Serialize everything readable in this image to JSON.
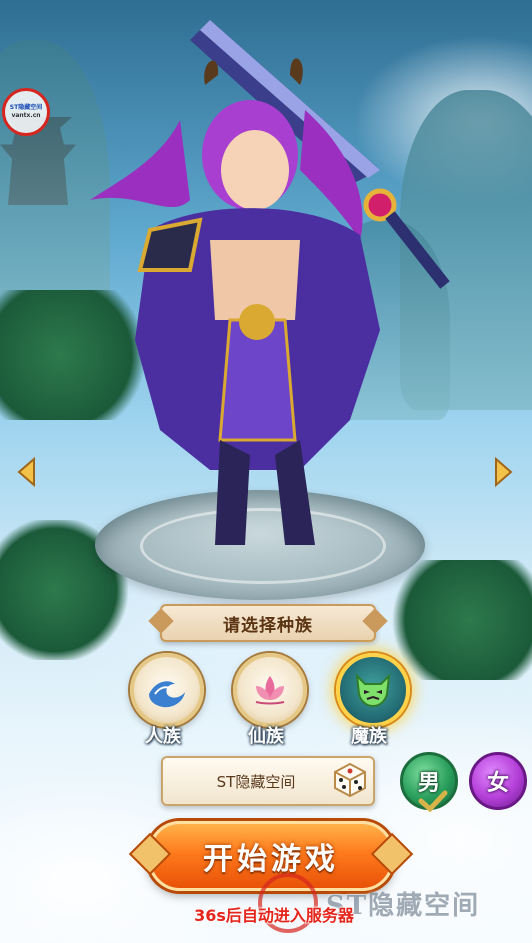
{
  "logo": {
    "line1": "ST隐藏空间",
    "line2": "vantx.cn"
  },
  "race_prompt": "请选择种族",
  "races": [
    {
      "label": "人族",
      "icon": "wave-icon",
      "selected": false
    },
    {
      "label": "仙族",
      "icon": "lotus-icon",
      "selected": false
    },
    {
      "label": "魔族",
      "icon": "demon-mask-icon",
      "selected": true
    }
  ],
  "name_field": {
    "value": "ST隐藏空间"
  },
  "gender": {
    "male": "男",
    "female": "女",
    "selected": "male"
  },
  "start_button": "开始游戏",
  "countdown_text": "36s后自动进入服务器",
  "watermark": "ST隐藏空间",
  "colors": {
    "accent": "#ff7a1c",
    "selected_glow": "#ffd24a",
    "countdown": "#e4261c"
  }
}
